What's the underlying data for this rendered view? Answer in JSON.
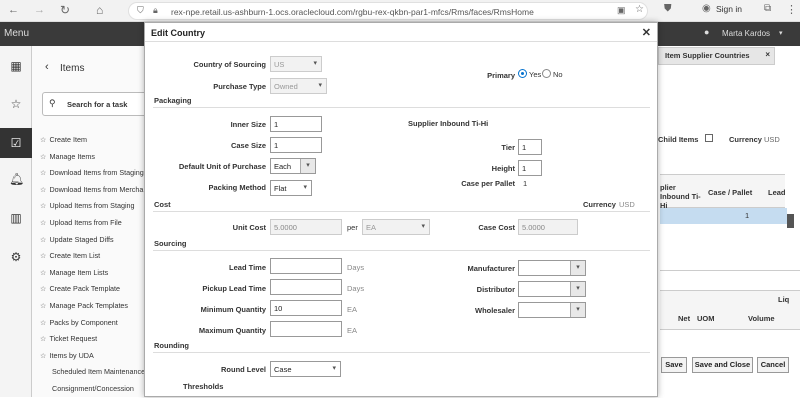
{
  "browser": {
    "url": "rex-npe.retail.us-ashburn-1.ocs.oraclecloud.com/rgbu-rex-qkbn-par1-mfcs/Rms/faces/RmsHome",
    "signin": "Sign in"
  },
  "header": {
    "menu": "Menu",
    "user": "Marta Kardos"
  },
  "tasks": {
    "title": "Items",
    "search_placeholder": "Search for a task",
    "items": [
      "Create Item",
      "Manage Items",
      "Download Items from Staging",
      "Download Items from Mercha",
      "Upload Items from Staging",
      "Upload Items from File",
      "Update Staged Diffs",
      "Create Item List",
      "Manage Item Lists",
      "Create Pack Template",
      "Manage Pack Templates",
      "Packs by Component",
      "Ticket Request",
      "Items by UDA",
      "Scheduled Item Maintenance",
      "Consignment/Concession"
    ]
  },
  "background": {
    "tab": "Item Supplier Countries",
    "child_items": "Child Items",
    "currency_label": "Currency",
    "currency_value": "USD",
    "col_inbound": "plier Inbound Ti-Hi",
    "col_case_pallet": "Case / Pallet",
    "col_lead": "Lead",
    "value_1": "1",
    "liq": "Liq",
    "col_net": "Net",
    "col_uom": "UOM",
    "col_volume": "Volume",
    "save": "Save",
    "save_close": "Save and Close",
    "cancel": "Cancel"
  },
  "dialog": {
    "title": "Edit Country",
    "country_label": "Country of Sourcing",
    "country_value": "US",
    "purchase_type_label": "Purchase Type",
    "purchase_type_value": "Owned",
    "primary_label": "Primary",
    "primary_yes": "Yes",
    "primary_no": "No",
    "packaging": {
      "section": "Packaging",
      "inner_size_label": "Inner Size",
      "inner_size": "1",
      "case_size_label": "Case Size",
      "case_size": "1",
      "default_uop_label": "Default Unit of Purchase",
      "default_uop": "Each",
      "packing_method_label": "Packing Method",
      "packing_method": "Flat",
      "tihi_title": "Supplier Inbound Ti-Hi",
      "tier_label": "Tier",
      "tier": "1",
      "height_label": "Height",
      "height": "1",
      "case_per_pallet_label": "Case per Pallet",
      "case_per_pallet": "1"
    },
    "cost": {
      "section": "Cost",
      "currency_label": "Currency",
      "currency_value": "USD",
      "unit_cost_label": "Unit Cost",
      "unit_cost": "5.0000",
      "per_label": "per",
      "per_value": "EA",
      "case_cost_label": "Case Cost",
      "case_cost": "5.0000"
    },
    "sourcing": {
      "section": "Sourcing",
      "lead_time_label": "Lead Time",
      "lead_time": "",
      "pickup_lead_time_label": "Pickup Lead Time",
      "pickup_lead_time": "",
      "days": "Days",
      "min_qty_label": "Minimum Quantity",
      "min_qty": "10",
      "max_qty_label": "Maximum Quantity",
      "max_qty": "",
      "ea": "EA",
      "manufacturer_label": "Manufacturer",
      "distributor_label": "Distributor",
      "wholesaler_label": "Wholesaler"
    },
    "rounding": {
      "section": "Rounding",
      "round_level_label": "Round Level",
      "round_level": "Case"
    },
    "thresholds": {
      "section": "Thresholds"
    }
  }
}
